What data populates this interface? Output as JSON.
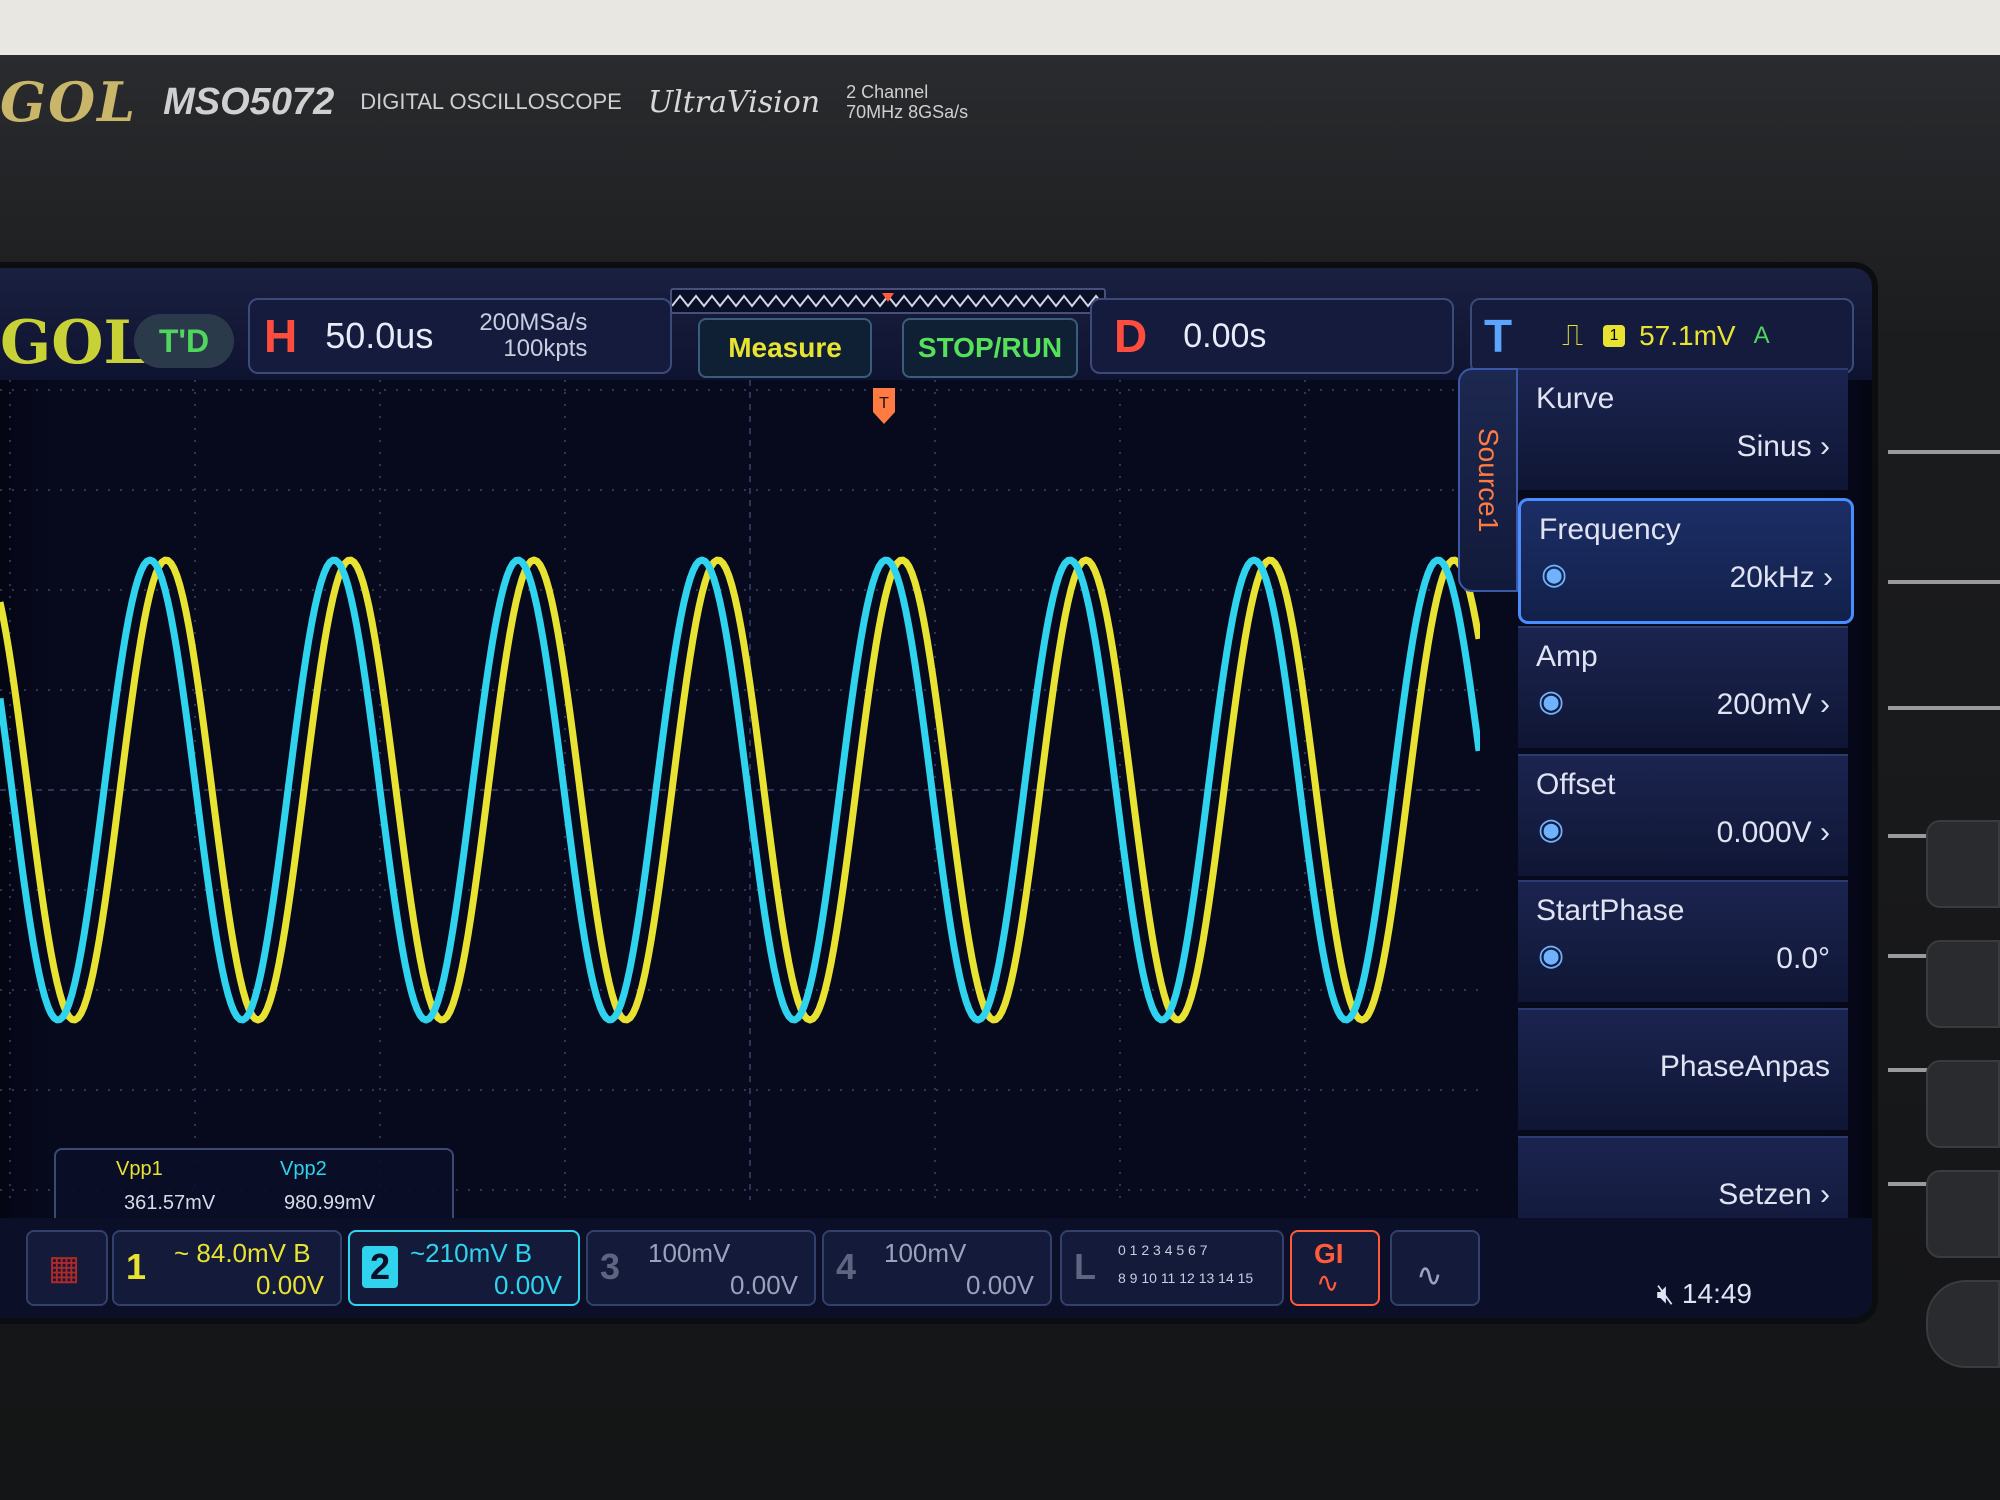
{
  "device": {
    "brand": "GOL",
    "model": "MSO5072",
    "subtitle": "DIGITAL OSCILLOSCOPE",
    "series": "UltraVision",
    "spec_line1": "2 Channel",
    "spec_line2": "70MHz 8GSa/s"
  },
  "topbar": {
    "logo": "GOL",
    "run_state": "T'D",
    "horizontal": {
      "letter": "H",
      "timebase": "50.0us",
      "sample_rate": "200MSa/s",
      "memory_depth": "100kpts"
    },
    "measure_button": "Measure",
    "stoprun_button": "STOP/RUN",
    "delay": {
      "letter": "D",
      "value": "0.00s"
    },
    "trigger": {
      "letter": "T",
      "source": "1",
      "level": "57.1mV",
      "mode": "A"
    }
  },
  "measurements": {
    "vpp1_label": "Vpp1",
    "vpp1_value": "361.57mV",
    "vpp2_label": "Vpp2",
    "vpp2_value": "980.99mV"
  },
  "menu": {
    "tab": "Source1",
    "items": [
      {
        "title": "Kurve",
        "value": "Sinus"
      },
      {
        "title": "Frequency",
        "value": "20kHz"
      },
      {
        "title": "Amp",
        "value": "200mV"
      },
      {
        "title": "Offset",
        "value": "0.000V"
      },
      {
        "title": "StartPhase",
        "value": "0.0°"
      },
      {
        "title": "",
        "value": "PhaseAnpas"
      },
      {
        "title": "",
        "value": "Setzen"
      }
    ]
  },
  "channels": [
    {
      "num": "1",
      "scale": "~ 84.0mV  B",
      "offset": "0.00V",
      "color": "#e8e332"
    },
    {
      "num": "2",
      "scale": "~210mV  B",
      "offset": "0.00V",
      "color": "#2fd3ee"
    },
    {
      "num": "3",
      "scale": "100mV",
      "offset": "0.00V",
      "color": "#5c6680"
    },
    {
      "num": "4",
      "scale": "100mV",
      "offset": "0.00V",
      "color": "#5c6680"
    }
  ],
  "logic": {
    "label": "L",
    "row1": "0 1 2 3  4 5 6 7",
    "row2": "8 9 10 11 12 13 14 15"
  },
  "gen": {
    "label": "GI"
  },
  "clock": "14:49",
  "colors": {
    "ch1": "#e8e332",
    "ch2": "#2fd3ee",
    "screen_bg": "#07091c",
    "accent": "#ff4d3d"
  }
}
